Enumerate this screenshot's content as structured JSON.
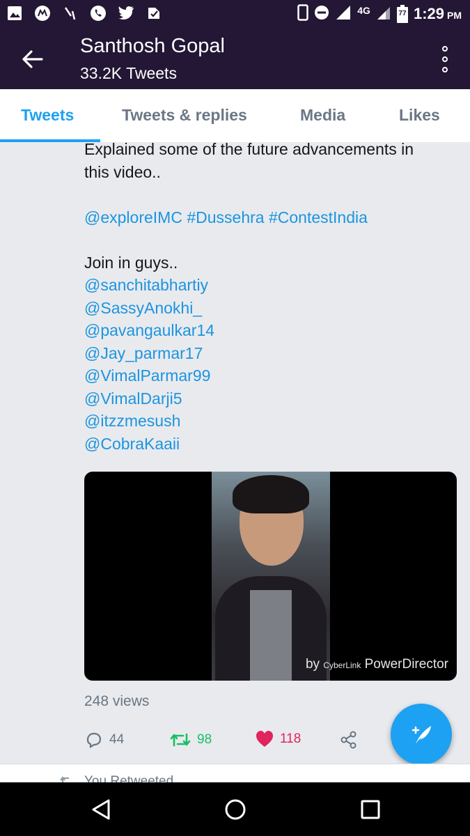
{
  "status_bar": {
    "time": "1:29",
    "ampm": "PM",
    "network": "4G",
    "battery": "77",
    "icons": [
      "gallery-icon",
      "motorola-icon",
      "missed-call-icon",
      "whatsapp-icon",
      "twitter-icon",
      "bookmyshow-icon"
    ]
  },
  "header": {
    "title": "Santhosh Gopal",
    "subtitle": "33.2K Tweets"
  },
  "tabs": [
    {
      "label": "Tweets",
      "active": true
    },
    {
      "label": "Tweets & replies",
      "active": false
    },
    {
      "label": "Media",
      "active": false
    },
    {
      "label": "Likes",
      "active": false
    }
  ],
  "tweet": {
    "text_line1": "Explained some of the future advancements in",
    "text_line2": "this video..",
    "hashtags": [
      "@exploreIMC",
      "#Dussehra",
      "#ContestIndia"
    ],
    "join_text": "Join in guys..",
    "mentions": [
      "@sanchitabhartiy",
      "@SassyAnokhi_",
      "@pavangaulkar14",
      "@Jay_parmar17",
      "@VimalParmar99",
      "@VimalDarji5",
      "@itzzmesush",
      "@CobraKaaii"
    ],
    "video_watermark_prefix": "by",
    "video_watermark_small": "CyberLink",
    "video_watermark": "PowerDirector",
    "views": "248 views",
    "replies": "44",
    "retweets": "98",
    "likes": "118"
  },
  "next_item": {
    "text": "You Retweeted"
  },
  "colors": {
    "bar": "#231735",
    "accent": "#1da1f2",
    "link": "#1b95e0",
    "retweet": "#17bf63",
    "like": "#e0245e"
  }
}
